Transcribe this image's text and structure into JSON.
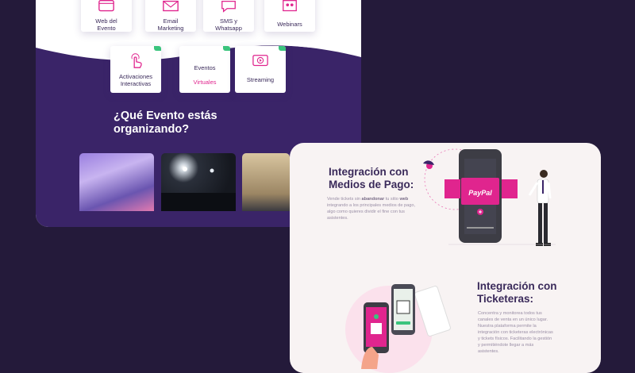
{
  "back_card": {
    "tiles_row1": [
      {
        "label": "Web del\nEvento",
        "icon": "web-icon"
      },
      {
        "label": "Email\nMarketing",
        "icon": "email-icon"
      },
      {
        "label": "SMS y\nWhatsapp",
        "icon": "chat-icon"
      },
      {
        "label": "Webinars",
        "icon": "webinar-icon"
      }
    ],
    "tiles_row2": [
      {
        "label": "Activaciones\nInteractivas",
        "icon": "touch-icon"
      },
      {
        "label_top": "Eventos",
        "label_bottom": "Virtuales",
        "icon": "virtual-event-icon"
      },
      {
        "label": "Streaming",
        "icon": "streaming-icon"
      }
    ],
    "question_title": "¿Qué Evento estás\norganizando?"
  },
  "front_card": {
    "section1": {
      "title": "Integración con\nMedios de Pago:",
      "body_pre": "Vende tickets sin ",
      "body_bold1": "abandonar",
      "body_mid": " tu sitio ",
      "body_bold2": "web",
      "body_post": " integrando a los principales medios de pago, algo como quieres dividir el fine con tus asistentes."
    },
    "paypal_label": "PayPal",
    "section2": {
      "title": "Integración con\nTicketeras:",
      "body": "Concentra y monitorea todos tus canales de venta en un único lugar. Nuestra plataforma permite la integración con ticketeras electrónicas y tickets físicos. Facilitando la gestión y permitiéndote llegar a más asistentes."
    }
  },
  "colors": {
    "background": "#241a3a",
    "purple": "#3a2468",
    "pink": "#e0258e",
    "green": "#3ac47d"
  }
}
